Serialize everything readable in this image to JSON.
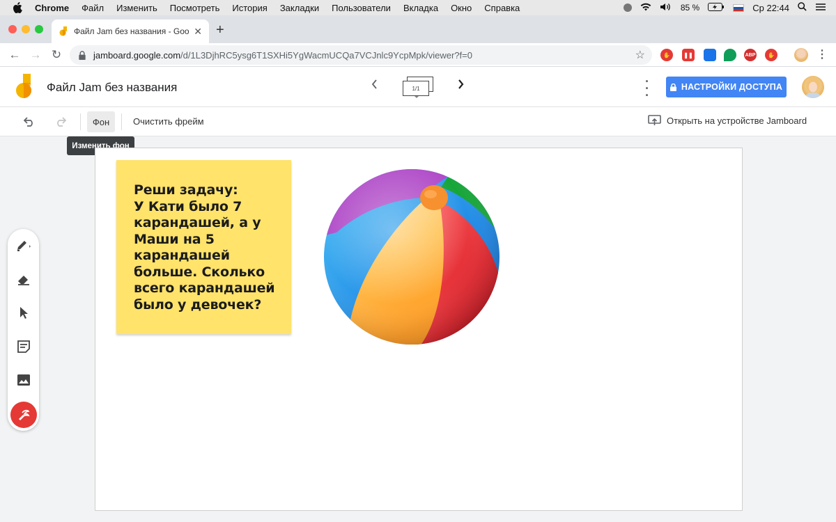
{
  "mac_menubar": {
    "app_name": "Chrome",
    "menus": [
      "Файл",
      "Изменить",
      "Посмотреть",
      "История",
      "Закладки",
      "Пользователи",
      "Вкладка",
      "Окно",
      "Справка"
    ],
    "battery": "85 %",
    "clock": "Ср 22:44"
  },
  "browser": {
    "tab_title": "Файл Jam без названия - Goo",
    "url_host": "jamboard.google.com",
    "url_path": "/d/1L3DjhRC5ysg6T1SXHi5YgWacmUCQa7VCJnlc9YcpMpk/viewer?f=0",
    "extensions": [
      {
        "name": "stop-icon",
        "color": "#e53935",
        "label": "✋"
      },
      {
        "name": "pause-icon",
        "color": "#e53935",
        "label": "❚❚"
      },
      {
        "name": "bookmark-icon",
        "color": "#1a73e8",
        "label": ""
      },
      {
        "name": "hangouts-icon",
        "color": "#0f9d58",
        "label": ""
      },
      {
        "name": "adblock-icon",
        "color": "#d32f2f",
        "label": "ABP"
      },
      {
        "name": "hand-icon",
        "color": "#e53935",
        "label": "✋"
      }
    ]
  },
  "jamboard": {
    "file_title": "Файл Jam без названия",
    "frame_counter": "1/1",
    "share_label": "НАСТРОЙКИ ДОСТУПА",
    "toolbar": {
      "background_label": "Фон",
      "clear_frame_label": "Очистить фрейм",
      "open_device_label": "Открыть на устройстве Jamboard"
    },
    "tooltip": "Изменить фон",
    "sticky_note": {
      "text": "Реши задачу:\nУ Кати было 7\nкарандашей, а у\nМаши на 5\nкарандашей\nбольше. Сколько\nвсего карандашей\nбыло у девочек?",
      "color": "#ffe36b"
    }
  },
  "colors": {
    "accent": "#4285f4",
    "laser": "#e53935"
  }
}
